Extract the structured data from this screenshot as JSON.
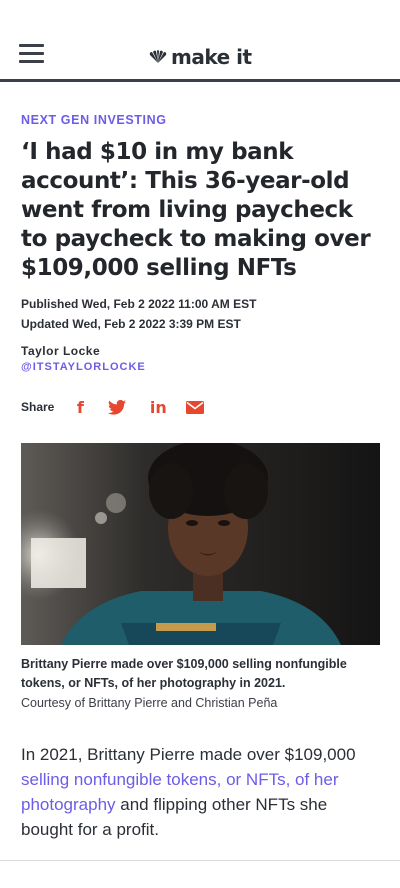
{
  "header": {
    "logo_text": "make it",
    "logo_icon": "peacock-icon",
    "menu_icon": "hamburger-menu-icon"
  },
  "article": {
    "kicker": "NEXT GEN INVESTING",
    "headline": "‘I had $10 in my bank account’: This 36-year-old went from living paycheck to paycheck to making over $109,000 selling NFTs",
    "published": "Published Wed, Feb 2 2022 11:00 AM EST",
    "updated": "Updated Wed, Feb 2 2022 3:39 PM EST",
    "author_name": "Taylor Locke",
    "author_handle": "@ITSTAYLORLOCKE",
    "share_label": "Share",
    "share_icons": [
      "facebook-icon",
      "twitter-icon",
      "linkedin-icon",
      "email-icon"
    ],
    "photo_caption": "Brittany Pierre made over $109,000 selling nonfungible tokens, or NFTs, of her photography in 2021.",
    "photo_credit": "Courtesy of Brittany Pierre and Christian Peña",
    "body_before_link": "In 2021, Brittany Pierre made over $109,000 ",
    "body_link": "selling nonfungible tokens, or NFTs, of her photography",
    "body_after_link": " and flipping other NFTs she bought for a profit."
  },
  "colors": {
    "accent": "#6c5ce7",
    "share": "#e8472f",
    "text": "#23262b"
  }
}
